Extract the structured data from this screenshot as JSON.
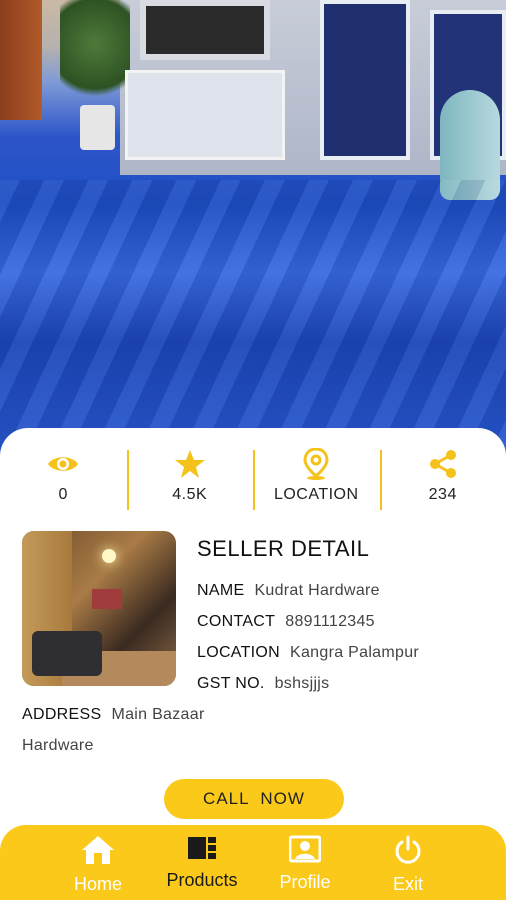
{
  "stats": [
    {
      "icon": "eye-icon",
      "value": "0"
    },
    {
      "icon": "star-icon",
      "value": "4.5K"
    },
    {
      "icon": "location-pin-icon",
      "value": "LOCATION"
    },
    {
      "icon": "share-icon",
      "value": "234"
    }
  ],
  "seller": {
    "title": "SELLER DETAIL",
    "name_label": "NAME",
    "name": "Kudrat Hardware",
    "contact_label": "CONTACT",
    "contact": "8891112345",
    "location_label": "LOCATION",
    "location": "Kangra Palampur",
    "gst_label": "GST NO.",
    "gst": "bshsjjjs",
    "address_label": "ADDRESS",
    "address_line1": "Main Bazaar",
    "address_line2": "Hardware"
  },
  "call_button": "CALL  NOW",
  "nav": [
    {
      "icon": "home-icon",
      "label": "Home",
      "active": false
    },
    {
      "icon": "products-icon",
      "label": "Products",
      "active": true
    },
    {
      "icon": "profile-icon",
      "label": "Profile",
      "active": false
    },
    {
      "icon": "power-icon",
      "label": "Exit",
      "active": false
    }
  ],
  "colors": {
    "accent": "#fbc91a",
    "icon": "#f4c21b"
  }
}
